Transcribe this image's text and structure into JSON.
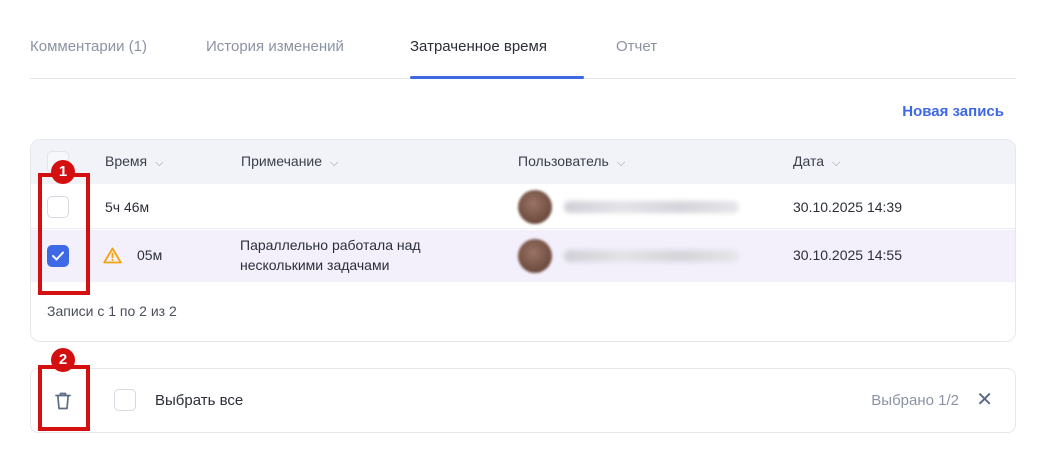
{
  "tabs": [
    {
      "label": "Комментарии (1)",
      "active": false
    },
    {
      "label": "История изменений",
      "active": false
    },
    {
      "label": "Затраченное время",
      "active": true
    },
    {
      "label": "Отчет",
      "active": false
    }
  ],
  "new_record_label": "Новая запись",
  "table": {
    "headers": [
      "Время",
      "Примечание",
      "Пользователь",
      "Дата"
    ],
    "header_icon": "chevron-down-icon",
    "rows": [
      {
        "checked": false,
        "warning": false,
        "time": "5ч 46м",
        "note_line1": "",
        "note_line2": "",
        "user": "",
        "date": "30.10.2025 14:39"
      },
      {
        "checked": true,
        "warning": true,
        "time": "05м",
        "note_line1": "Параллельно работала над",
        "note_line2": "несколькими задачами",
        "user": "",
        "date": "30.10.2025 14:55"
      }
    ],
    "footer": "Записи с 1 по 2 из 2"
  },
  "actionbar": {
    "delete_icon": "trash-icon",
    "select_all_label": "Выбрать все",
    "selected_count": "Выбрано 1/2",
    "close_icon": "close-icon"
  },
  "annotations": [
    "1",
    "2"
  ],
  "colors": {
    "accent": "#3d68e6",
    "annotation": "#d40f0f",
    "selected_row": "#f3effb",
    "warning": "#f2a20c"
  }
}
